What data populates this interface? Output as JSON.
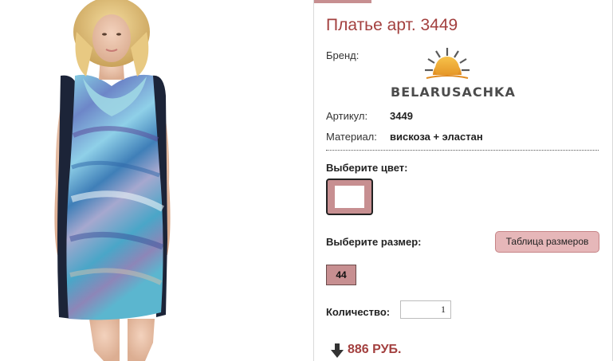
{
  "product": {
    "title": "Платье арт. 3449",
    "brand_label": "Бренд:",
    "brand_name": "BELARUSACHKA",
    "article_label": "Артикул:",
    "article_value": "3449",
    "material_label": "Материал:",
    "material_value": "вискоза + эластан"
  },
  "color": {
    "label": "Выберите цвет:",
    "swatch_color": "#ffffff"
  },
  "size": {
    "label": "Выберите размер:",
    "table_button": "Таблица размеров",
    "options": [
      "44"
    ]
  },
  "quantity": {
    "label": "Количество:",
    "value": "1"
  },
  "price": {
    "text": "886 РУБ."
  },
  "colors": {
    "accent": "#a3403f",
    "chip": "#c78f91",
    "button": "#e6b7b9"
  }
}
